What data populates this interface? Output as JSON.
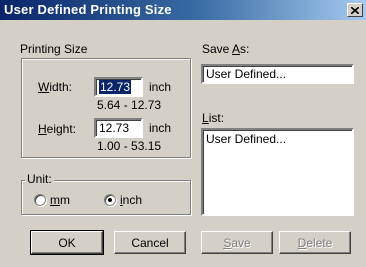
{
  "window": {
    "title": "User Defined Printing Size"
  },
  "printing_size": {
    "group_label": "Printing Size",
    "width": {
      "label_pre": "",
      "label_mnemonic": "W",
      "label_post": "idth:",
      "value": "12.73",
      "unit": "inch",
      "range": "5.64 - 12.73"
    },
    "height": {
      "label_pre": "",
      "label_mnemonic": "H",
      "label_post": "eight:",
      "value": "12.73",
      "unit": "inch",
      "range": "1.00 - 53.15"
    }
  },
  "unit": {
    "group_label": "Unit:",
    "options": [
      {
        "mnemonic": "m",
        "rest": "m",
        "selected": false
      },
      {
        "mnemonic": "i",
        "rest": "nch",
        "selected": true
      }
    ]
  },
  "save_as": {
    "label_pre": "Save ",
    "label_mnemonic": "A",
    "label_post": "s:",
    "value": "User Defined..."
  },
  "list": {
    "label_pre": "",
    "label_mnemonic": "L",
    "label_post": "ist:",
    "items": [
      "User Defined..."
    ]
  },
  "buttons": {
    "ok": "OK",
    "cancel": "Cancel",
    "save_mnemonic": "S",
    "save_rest": "ave",
    "delete_mnemonic": "D",
    "delete_rest": "elete"
  },
  "colors": {
    "title_bar_start": "#0a246a",
    "title_bar_end": "#a6caf0",
    "dialog_face": "#d4d0c8",
    "selection": "#0a246a"
  },
  "icons": {
    "close": "close-icon",
    "radio_selected": "radio-selected-icon",
    "radio_unselected": "radio-unselected-icon"
  }
}
